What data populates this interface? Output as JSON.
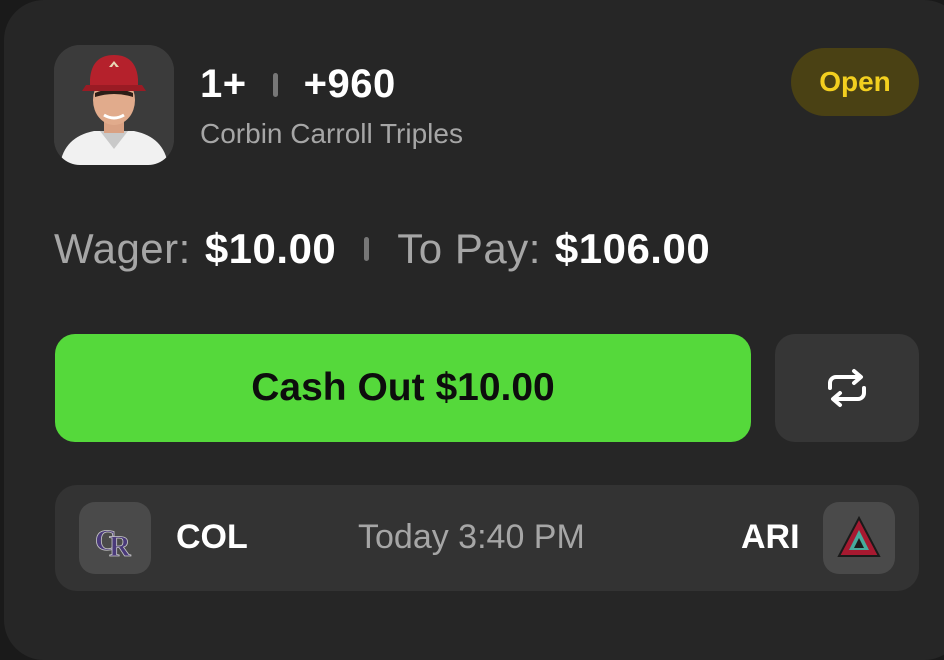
{
  "bet": {
    "line": "1+",
    "odds": "+960",
    "market": "Corbin Carroll Triples",
    "status": "Open",
    "player_photo": "player-headshot"
  },
  "amounts": {
    "wager_label": "Wager:",
    "wager_value": "$10.00",
    "topay_label": "To Pay:",
    "topay_value": "$106.00"
  },
  "actions": {
    "cashout_label": "Cash Out $10.00",
    "refresh_icon": "refresh-arrows-icon"
  },
  "game": {
    "home_team": "COL",
    "home_logo": "rockies-cr-logo",
    "time": "Today 3:40 PM",
    "away_team": "ARI",
    "away_logo": "diamondbacks-a-logo"
  },
  "colors": {
    "status_text": "#f3cf1f",
    "status_bg": "#4a4114",
    "cashout_bg": "#55d93b",
    "card_bg": "#262626"
  }
}
